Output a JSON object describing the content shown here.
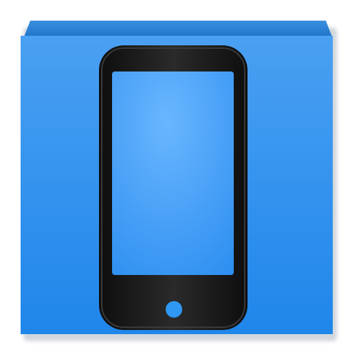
{
  "icon": {
    "name": "phone-app-icon",
    "depicts": "smartphone-icon",
    "colors": {
      "background": "#ffffff",
      "tile_top": "#4aa0f2",
      "tile_bottom": "#1f86ea",
      "tile_shadow": "#a9b3bd",
      "phone_body": "#151515",
      "phone_bezel": "#2b2b2b",
      "screen_center": "#69b6ff",
      "screen_edge": "#2e8ff0",
      "home_button": "#2f98f3"
    }
  }
}
